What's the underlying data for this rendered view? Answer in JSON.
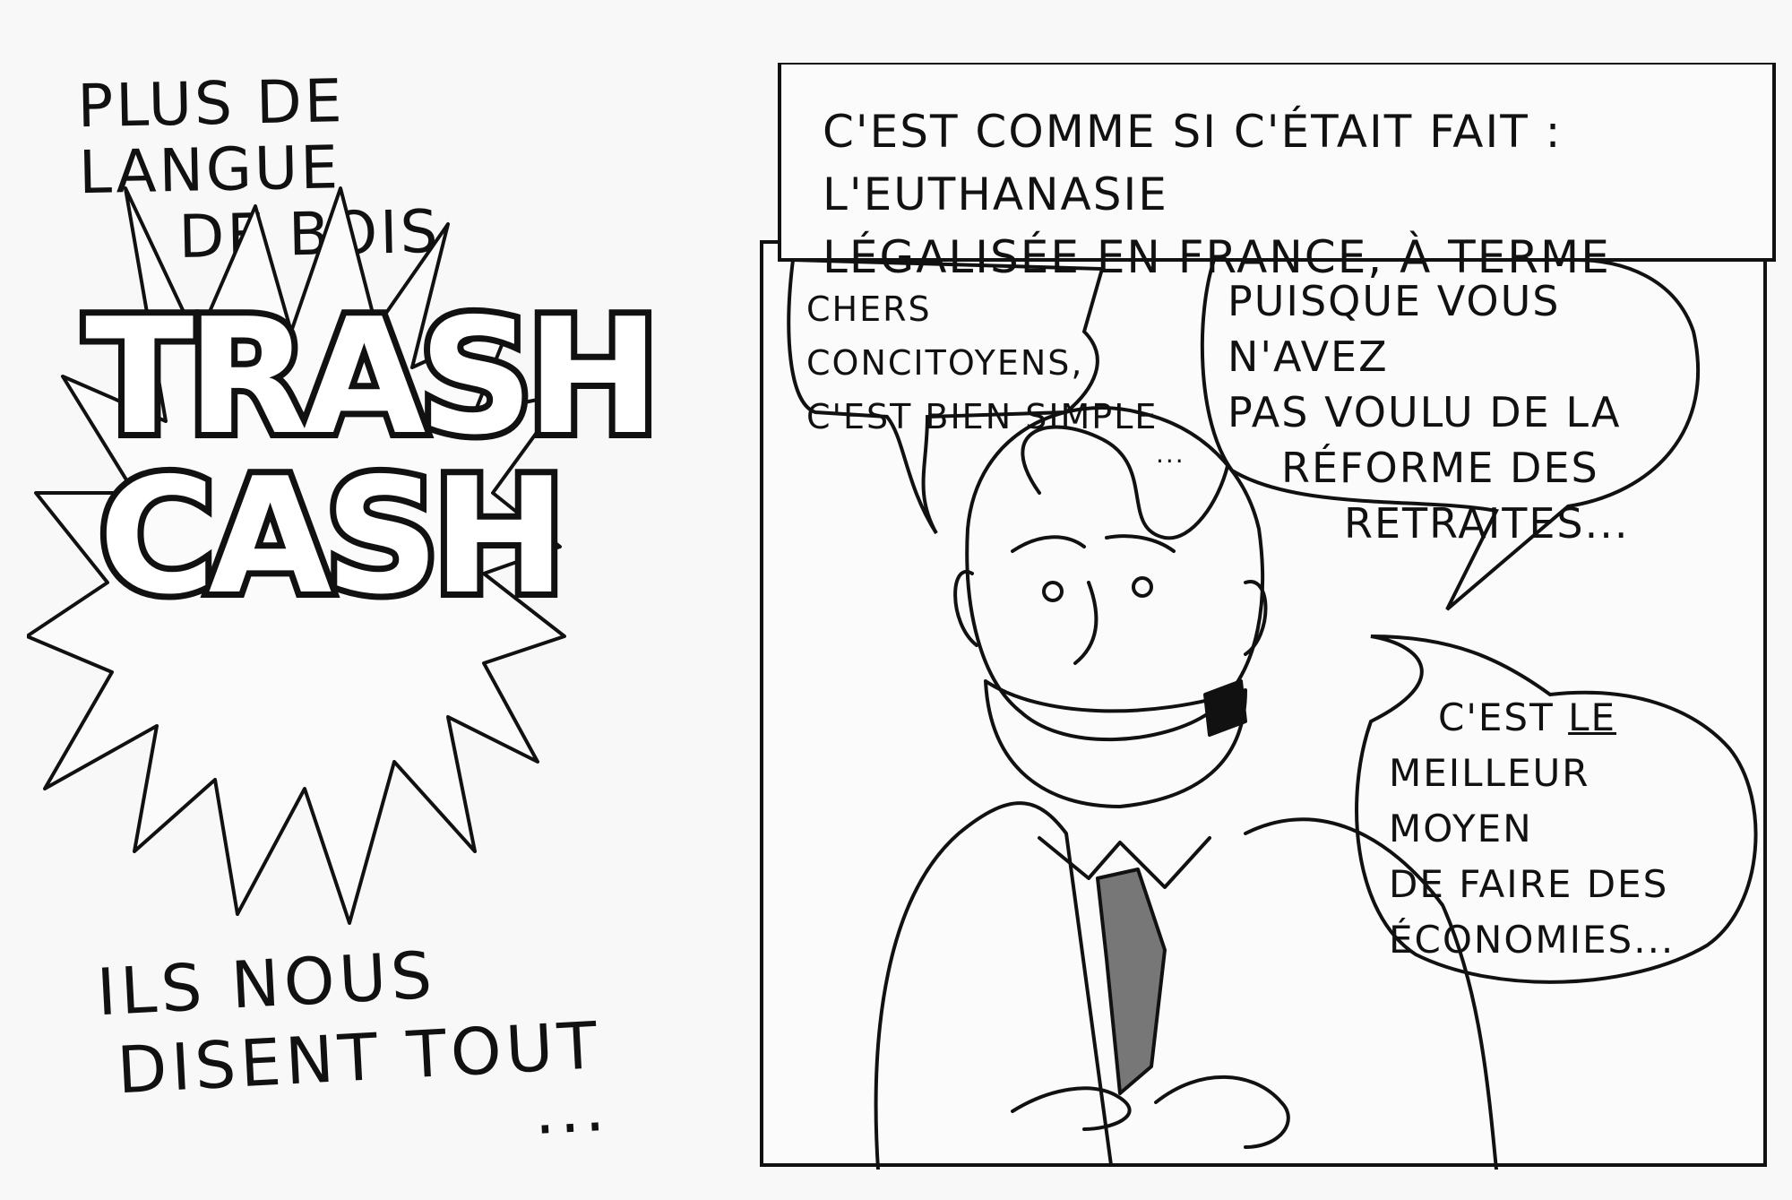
{
  "left": {
    "top_caption_line1": "PLUS DE LANGUE",
    "top_caption_line2": "DE BOIS",
    "logo_line1": "TRASH",
    "logo_line2": "CASH",
    "bottom_caption_line1": "ILS NOUS",
    "bottom_caption_line2": "DISENT TOUT",
    "bottom_caption_ellipsis": "..."
  },
  "right": {
    "caption_line1": "C'EST COMME SI C'ÉTAIT FAIT : L'EUTHANASIE",
    "caption_line2": "LÉGALISÉE EN FRANCE, À TERME",
    "balloon1_line1": "CHERS CONCITOYENS,",
    "balloon1_line2": "C'EST BIEN SIMPLE",
    "balloon1_line3": "...",
    "balloon2_line1": "PUISQUE VOUS N'AVEZ",
    "balloon2_line2": "PAS VOULU DE LA",
    "balloon2_line3": "RÉFORME DES",
    "balloon2_line4": "RETRAITES...",
    "balloon3_line1_pre": "C'EST ",
    "balloon3_line1_em": "LE",
    "balloon3_line2": "MEILLEUR MOYEN",
    "balloon3_line3": "DE FAIRE DES",
    "balloon3_line4": "ÉCONOMIES..."
  }
}
